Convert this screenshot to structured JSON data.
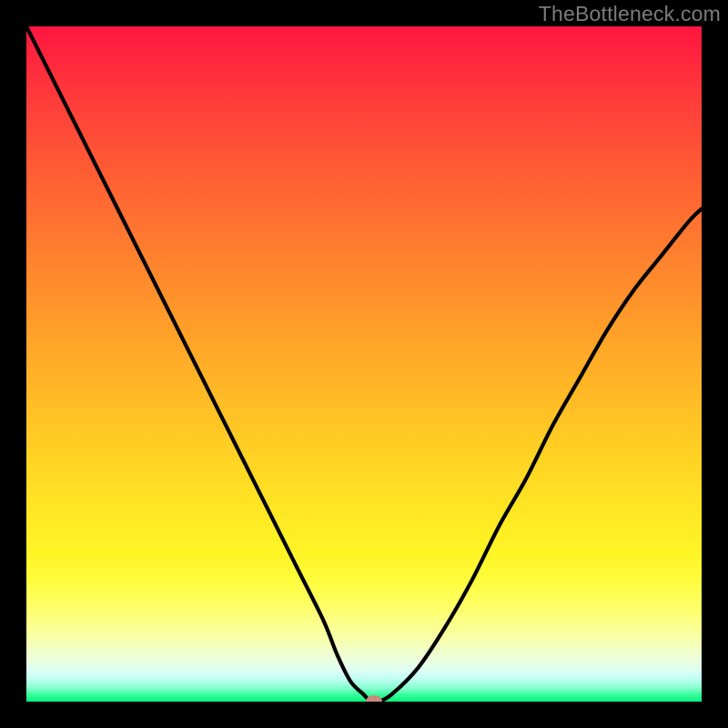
{
  "watermark": "TheBottleneck.com",
  "colors": {
    "frame": "#000000",
    "curve": "#000000",
    "marker": "#c98b7e"
  },
  "chart_data": {
    "type": "line",
    "title": "",
    "xlabel": "",
    "ylabel": "",
    "xlim": [
      0,
      100
    ],
    "ylim": [
      0,
      100
    ],
    "grid": false,
    "series": [
      {
        "name": "bottleneck-curve",
        "x": [
          0,
          4,
          8,
          12,
          16,
          20,
          24,
          28,
          32,
          36,
          40,
          44,
          46,
          48,
          50,
          51,
          52,
          54,
          58,
          62,
          66,
          70,
          74,
          78,
          82,
          86,
          90,
          94,
          98,
          100
        ],
        "y": [
          100,
          92,
          84,
          76,
          68,
          60,
          52,
          44,
          36,
          28,
          20,
          12,
          7,
          3,
          1,
          0,
          0,
          1,
          5,
          11,
          18,
          26,
          33,
          41,
          48,
          55,
          61,
          66,
          71,
          73
        ]
      }
    ],
    "marker": {
      "x": 51.5,
      "y": 0
    },
    "note": "Values estimated from pixel positions; chart has no visible axes, ticks, or labels."
  }
}
